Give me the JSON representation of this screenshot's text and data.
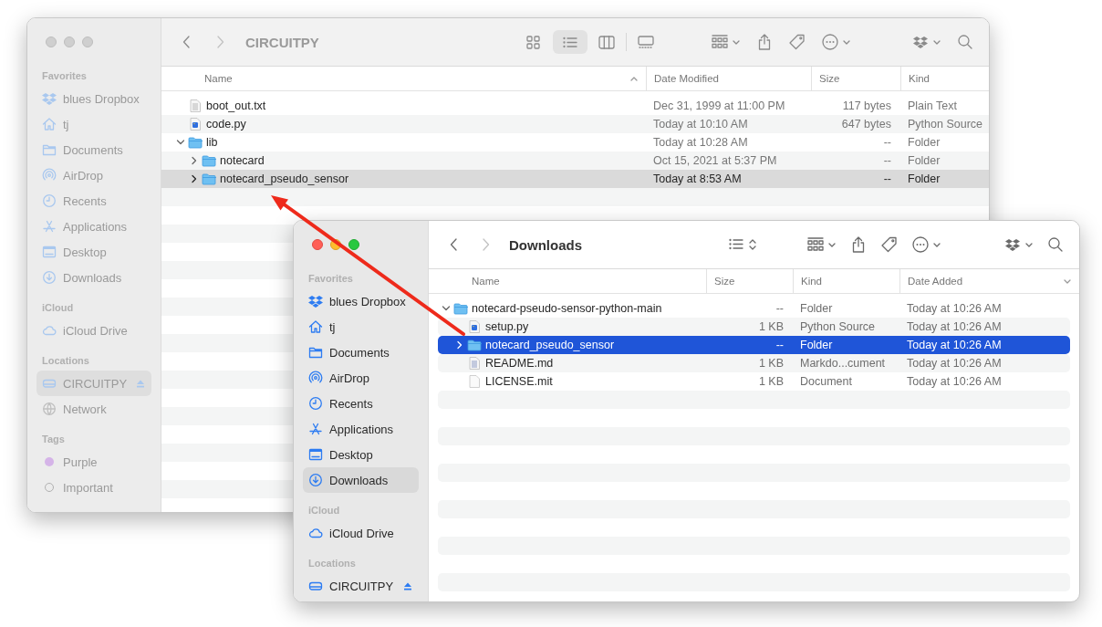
{
  "windows": [
    {
      "active": false,
      "toolbar": {
        "title": "CIRCUITPY",
        "views": [
          {
            "kind": "icons",
            "selected": false
          },
          {
            "kind": "list",
            "selected": true
          },
          {
            "kind": "columns",
            "selected": false
          },
          {
            "kind": "gallery",
            "selected": false
          }
        ]
      },
      "sidebar": {
        "sections": [
          {
            "title": "Favorites",
            "items": [
              {
                "label": "blues Dropbox",
                "kind": "dropbox",
                "selected": false
              },
              {
                "label": "tj",
                "kind": "home",
                "selected": false
              },
              {
                "label": "Documents",
                "kind": "folder",
                "selected": false
              },
              {
                "label": "AirDrop",
                "kind": "airdrop",
                "selected": false
              },
              {
                "label": "Recents",
                "kind": "clock",
                "selected": false
              },
              {
                "label": "Applications",
                "kind": "apps",
                "selected": false
              },
              {
                "label": "Desktop",
                "kind": "desktop",
                "selected": false
              },
              {
                "label": "Downloads",
                "kind": "download",
                "selected": false
              }
            ]
          },
          {
            "title": "iCloud",
            "items": [
              {
                "label": "iCloud Drive",
                "kind": "cloud",
                "selected": false
              }
            ]
          },
          {
            "title": "Locations",
            "items": [
              {
                "label": "CIRCUITPY",
                "kind": "drive",
                "selected": true
              },
              {
                "label": "Network",
                "kind": "network",
                "selected": false
              }
            ]
          },
          {
            "title": "Tags",
            "items": [
              {
                "label": "Purple",
                "kind": "tag",
                "color": "#d5b4e8",
                "selected": false
              },
              {
                "label": "Important",
                "kind": "tag",
                "selected": false
              }
            ]
          }
        ]
      },
      "list": {
        "columns": [
          {
            "label": "Name",
            "kind": "name",
            "sorted": true,
            "descending": false
          },
          {
            "label": "Date Modified",
            "kind": "date"
          },
          {
            "label": "Size",
            "kind": "size"
          },
          {
            "label": "Kind",
            "kind": "kind"
          }
        ],
        "rows": [
          {
            "name": "boot_out.txt",
            "kind": "text",
            "values": [
              "Dec 31, 1999 at 11:00 PM",
              "117 bytes",
              "Plain Text"
            ],
            "selected": false
          },
          {
            "name": "code.py",
            "kind": "python",
            "values": [
              "Today at 10:10 AM",
              "647 bytes",
              "Python Source"
            ],
            "selected": false
          },
          {
            "name": "lib",
            "kind": "folder",
            "expanded": true,
            "values": [
              "Today at 10:28 AM",
              "--",
              "Folder"
            ],
            "selected": false,
            "children": [
              {
                "name": "notecard",
                "kind": "folder",
                "expanded": false,
                "values": [
                  "Oct 15, 2021 at 5:37 PM",
                  "--",
                  "Folder"
                ],
                "selected": false
              },
              {
                "name": "notecard_pseudo_sensor",
                "kind": "folder",
                "expanded": false,
                "values": [
                  "Today at 8:53 AM",
                  "--",
                  "Folder"
                ],
                "selected": true
              }
            ]
          }
        ]
      }
    },
    {
      "active": true,
      "toolbar": {
        "title": "Downloads"
      },
      "sidebar": {
        "sections": [
          {
            "title": "Favorites",
            "items": [
              {
                "label": "blues Dropbox",
                "kind": "dropbox",
                "selected": false
              },
              {
                "label": "tj",
                "kind": "home",
                "selected": false
              },
              {
                "label": "Documents",
                "kind": "folder",
                "selected": false
              },
              {
                "label": "AirDrop",
                "kind": "airdrop",
                "selected": false
              },
              {
                "label": "Recents",
                "kind": "clock",
                "selected": false
              },
              {
                "label": "Applications",
                "kind": "apps",
                "selected": false
              },
              {
                "label": "Desktop",
                "kind": "desktop",
                "selected": false
              },
              {
                "label": "Downloads",
                "kind": "download",
                "selected": true
              }
            ]
          },
          {
            "title": "iCloud",
            "items": [
              {
                "label": "iCloud Drive",
                "kind": "cloud",
                "selected": false
              }
            ]
          },
          {
            "title": "Locations",
            "items": [
              {
                "label": "CIRCUITPY",
                "kind": "drive",
                "selected": false
              }
            ]
          }
        ]
      },
      "list": {
        "columns": [
          {
            "label": "Name",
            "kind": "name"
          },
          {
            "label": "Size",
            "kind": "size"
          },
          {
            "label": "Kind",
            "kind": "kind"
          },
          {
            "label": "Date Added",
            "kind": "date",
            "sorted": true,
            "descending": true
          }
        ],
        "rows": [
          {
            "name": "notecard-pseudo-sensor-python-main",
            "kind": "folder",
            "expanded": true,
            "values": [
              "--",
              "Folder",
              "Today at 10:26 AM"
            ],
            "selected": false,
            "children": [
              {
                "name": "setup.py",
                "kind": "python",
                "values": [
                  "1 KB",
                  "Python Source",
                  "Today at 10:26 AM"
                ],
                "selected": false
              },
              {
                "name": "notecard_pseudo_sensor",
                "kind": "folder",
                "expanded": false,
                "values": [
                  "--",
                  "Folder",
                  "Today at 10:26 AM"
                ],
                "selected": true
              },
              {
                "name": "README.md",
                "kind": "markdown",
                "values": [
                  "1 KB",
                  "Markdo...cument",
                  "Today at 10:26 AM"
                ],
                "selected": false
              },
              {
                "name": "LICENSE.mit",
                "kind": "document",
                "values": [
                  "1 KB",
                  "Document",
                  "Today at 10:26 AM"
                ],
                "selected": false
              }
            ]
          }
        ]
      }
    }
  ]
}
